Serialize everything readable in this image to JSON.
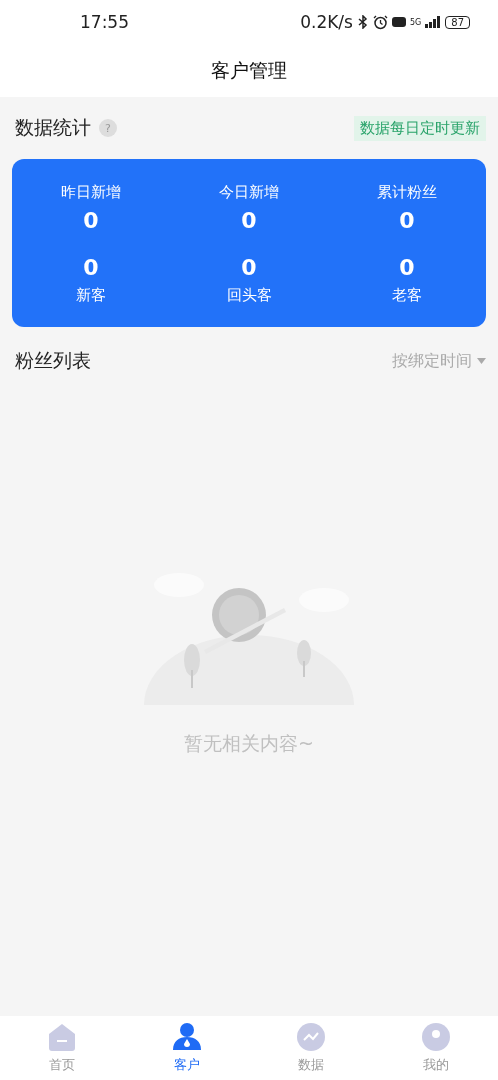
{
  "status_bar": {
    "time": "17:55",
    "speed": "0.2K/s",
    "network": "5G",
    "battery": "87"
  },
  "header": {
    "title": "客户管理"
  },
  "stats": {
    "title": "数据统计",
    "help": "?",
    "badge": "数据每日定时更新",
    "rows": [
      {
        "kind": "label-top",
        "items": [
          {
            "label": "昨日新增",
            "value": "0"
          },
          {
            "label": "今日新增",
            "value": "0"
          },
          {
            "label": "累计粉丝",
            "value": "0"
          }
        ]
      },
      {
        "kind": "label-bottom",
        "items": [
          {
            "label": "新客",
            "value": "0"
          },
          {
            "label": "回头客",
            "value": "0"
          },
          {
            "label": "老客",
            "value": "0"
          }
        ]
      }
    ]
  },
  "fans": {
    "title": "粉丝列表",
    "sort": "按绑定时间"
  },
  "empty": {
    "message": "暂无相关内容~"
  },
  "tabbar": [
    {
      "label": "首页",
      "kind": "home",
      "selected": false
    },
    {
      "label": "客户",
      "kind": "user",
      "selected": true
    },
    {
      "label": "数据",
      "kind": "chart",
      "selected": false
    },
    {
      "label": "我的",
      "kind": "me",
      "selected": false
    }
  ]
}
